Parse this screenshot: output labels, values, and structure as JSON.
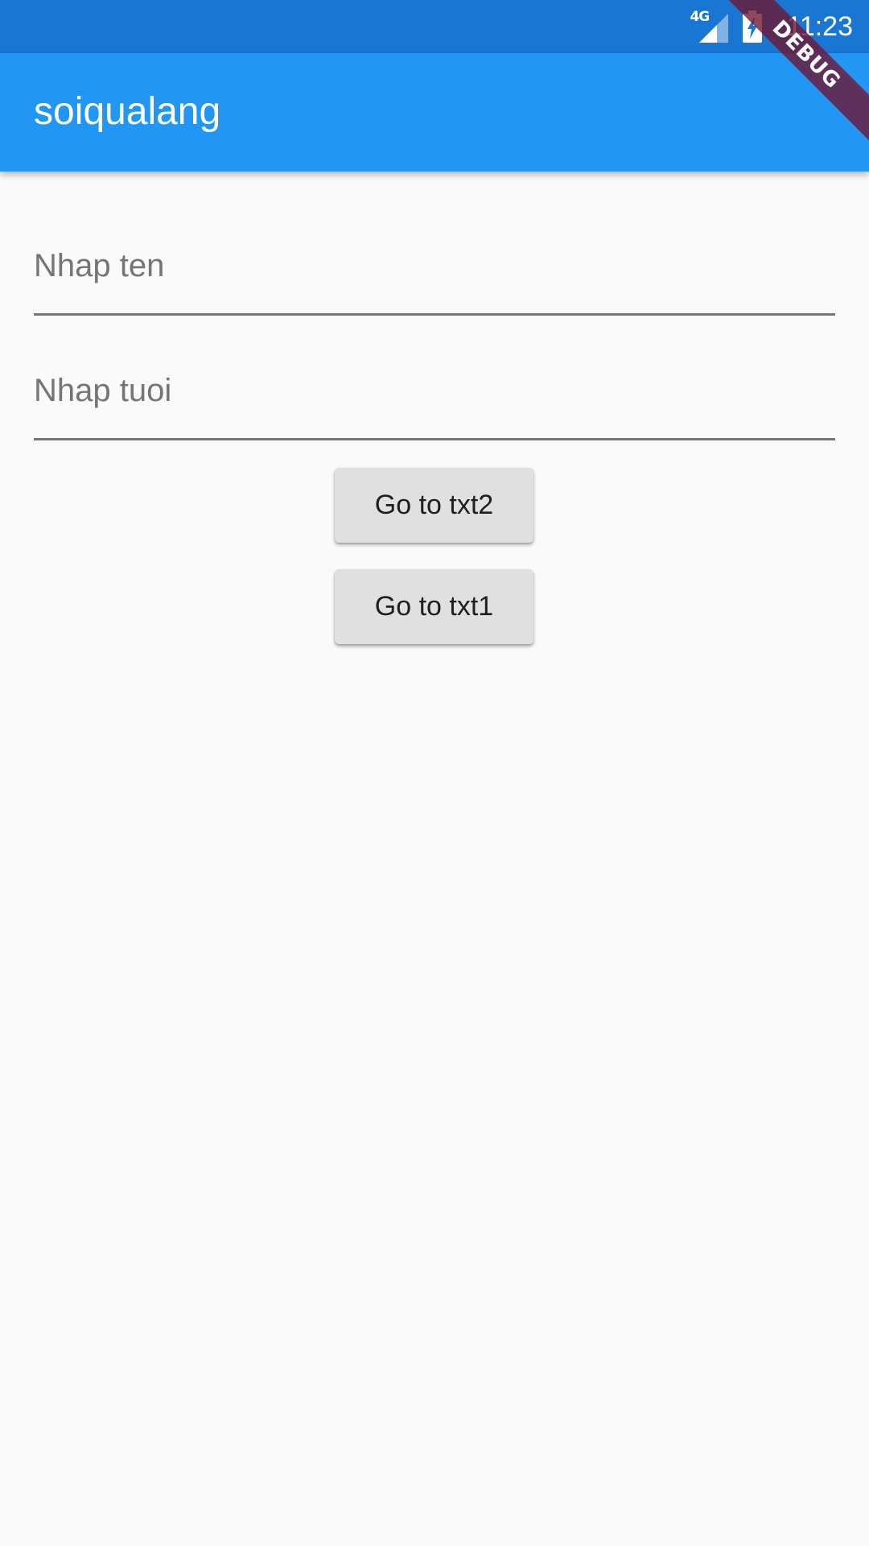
{
  "status_bar": {
    "network_type": "4G",
    "time": "11:23",
    "icons": [
      "signal-icon",
      "battery-charging-icon"
    ]
  },
  "app_bar": {
    "title": "soiqualang"
  },
  "debug_banner": {
    "label": "DEBUG"
  },
  "form": {
    "name_field": {
      "placeholder": "Nhap ten",
      "value": ""
    },
    "age_field": {
      "placeholder": "Nhap tuoi",
      "value": ""
    }
  },
  "buttons": {
    "go_to_txt2": "Go to txt2",
    "go_to_txt1": "Go to txt1"
  },
  "colors": {
    "status_bar": "#1976d2",
    "app_bar": "#2196f3",
    "background": "#fafafa",
    "button": "#e0e0e0",
    "underline": "#757575",
    "debug_ribbon": "#6e1530"
  }
}
